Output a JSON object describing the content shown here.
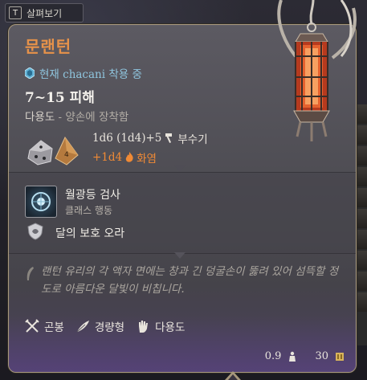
{
  "inspect_button": {
    "key": "T",
    "label": "살펴보기"
  },
  "item": {
    "name": "문랜턴",
    "equipped_by": "현재 chacani 착용 중",
    "damage": "7~15 피해",
    "proficiency_label": "다용도",
    "proficiency_detail": " - 양손에 장착함",
    "damage_roll": "1d6 (1d4)+5",
    "damage_type": "부수기",
    "bonus_roll": "+1d4",
    "bonus_type": "화염"
  },
  "action": {
    "name": "월광등 검사",
    "type": "클래스 행동",
    "aura": "달의 보호 오라"
  },
  "lore": "랜턴 유리의 각 액자 면에는 창과 긴 덩굴손이 뚫려 있어 섬뜩할 정도로 아름다운 달빛이 비칩니다.",
  "properties": [
    {
      "icon": "crossed-weapons-icon",
      "label": "곤봉"
    },
    {
      "icon": "feather-icon",
      "label": "경량형"
    },
    {
      "icon": "hand-icon",
      "label": "다용도"
    }
  ],
  "footer": {
    "weight": "0.9",
    "value": "30"
  },
  "colors": {
    "title": "#e6924a",
    "equipped": "#8fc5de",
    "fire": "#f08a35",
    "border": "#a7977c"
  }
}
